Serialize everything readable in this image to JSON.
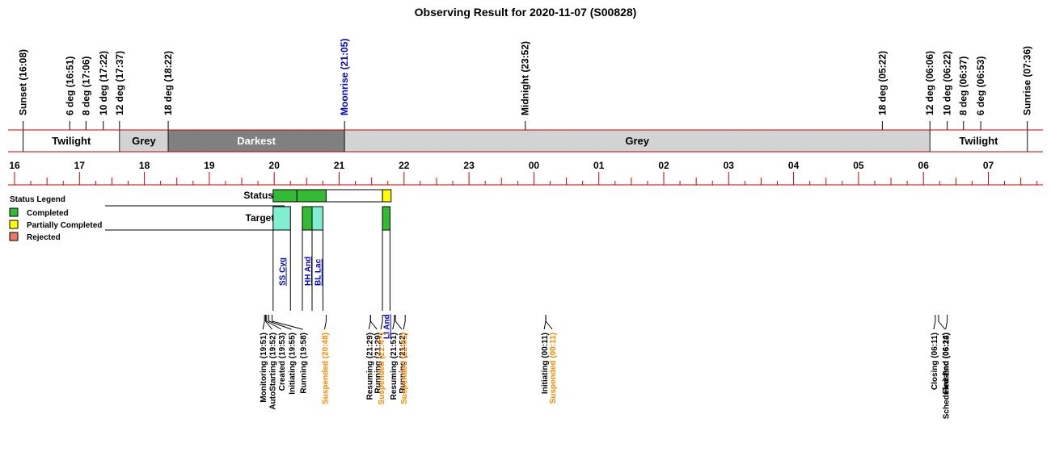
{
  "title": "Observing Result for 2020-11-07 (S00828)",
  "colors": {
    "rule": "#cc0000",
    "darkest": "#808080",
    "grey": "#d3d3d3",
    "twilight": "#ffffff",
    "completed": "#33bb33",
    "partial": "#ffff00",
    "rejected": "#ee7766",
    "target_fill": "#80eed0",
    "target_link": "#0000cc",
    "suspended": "#ff8800",
    "moonrise": "#0000cc"
  },
  "timeline": {
    "start_hour": 15.8,
    "end_hour": 31.75,
    "hour_labels": [
      "16",
      "17",
      "18",
      "19",
      "20",
      "21",
      "22",
      "23",
      "00",
      "01",
      "02",
      "03",
      "04",
      "05",
      "06",
      "07"
    ]
  },
  "bands": [
    {
      "label": "Twilight",
      "start": 16.133,
      "end": 17.617,
      "fill": "twilight"
    },
    {
      "label": "Grey",
      "start": 17.617,
      "end": 18.367,
      "fill": "grey"
    },
    {
      "label": "Darkest",
      "start": 18.367,
      "end": 21.083,
      "fill": "darkest"
    },
    {
      "label": "Grey",
      "start": 21.083,
      "end": 30.1,
      "fill": "grey"
    },
    {
      "label": "Twilight",
      "start": 30.1,
      "end": 31.6,
      "fill": "twilight"
    }
  ],
  "events": [
    {
      "label": "Sunset (16:08)",
      "time": 16.133,
      "color": "#000000"
    },
    {
      "label": "6 deg (16:51)",
      "time": 16.85,
      "color": "#000000"
    },
    {
      "label": "8 deg (17:06)",
      "time": 17.1,
      "color": "#000000"
    },
    {
      "label": "10 deg (17:22)",
      "time": 17.367,
      "color": "#000000"
    },
    {
      "label": "12 deg (17:37)",
      "time": 17.617,
      "color": "#000000"
    },
    {
      "label": "18 deg (18:22)",
      "time": 18.367,
      "color": "#000000"
    },
    {
      "label": "Moonrise (21:05)",
      "time": 21.083,
      "color": "#0000cc"
    },
    {
      "label": "Midnight (23:52)",
      "time": 23.867,
      "color": "#000000"
    },
    {
      "label": "18 deg (05:22)",
      "time": 29.367,
      "color": "#000000"
    },
    {
      "label": "12 deg (06:06)",
      "time": 30.1,
      "color": "#000000"
    },
    {
      "label": "10 deg (06:22)",
      "time": 30.367,
      "color": "#000000"
    },
    {
      "label": "8 deg (06:37)",
      "time": 30.617,
      "color": "#000000"
    },
    {
      "label": "6 deg (06:53)",
      "time": 30.883,
      "color": "#000000"
    },
    {
      "label": "Sunrise (07:36)",
      "time": 31.6,
      "color": "#000000"
    }
  ],
  "legend": {
    "title": "Status Legend",
    "items": [
      {
        "label": "Completed",
        "color": "completed"
      },
      {
        "label": "Partially Completed",
        "color": "partial"
      },
      {
        "label": "Rejected",
        "color": "rejected"
      }
    ]
  },
  "rows": {
    "status_label": "Status",
    "targets_label": "Targets"
  },
  "status_blocks": [
    {
      "start": 19.983,
      "end": 20.35,
      "state": "completed"
    },
    {
      "start": 20.35,
      "end": 20.8,
      "state": "completed"
    },
    {
      "start": 20.8,
      "end": 21.667,
      "state": "none"
    },
    {
      "start": 21.667,
      "end": 21.8,
      "state": "partial"
    }
  ],
  "targets": [
    {
      "name": "SS Cyg",
      "start": 19.983,
      "end": 20.25,
      "fill": "target_fill"
    },
    {
      "name": "HH And",
      "start": 20.433,
      "end": 20.583,
      "fill": "completed"
    },
    {
      "name": "BL Lac",
      "start": 20.583,
      "end": 20.75,
      "fill": "target_fill"
    },
    {
      "name": "LI And",
      "start": 21.667,
      "end": 21.783,
      "fill": "completed"
    }
  ],
  "log": [
    {
      "label": "Monitoring (19:51)",
      "time": 19.85,
      "suspended": false
    },
    {
      "label": "AutoStarting (19:52)",
      "time": 19.867,
      "suspended": false
    },
    {
      "label": "Created (19:53)",
      "time": 19.883,
      "suspended": false
    },
    {
      "label": "Initiating (19:55)",
      "time": 19.917,
      "suspended": false
    },
    {
      "label": "Running (19:58)",
      "time": 19.967,
      "suspended": false
    },
    {
      "label": "Suspended (20:48)",
      "time": 20.8,
      "suspended": true
    },
    {
      "label": "Resuming (21:29)",
      "time": 21.483,
      "suspended": false
    },
    {
      "label": "Running (21:29)",
      "time": 21.483,
      "suspended": false
    },
    {
      "label": "Suspended (21:4?)",
      "time": 21.667,
      "suspended": true
    },
    {
      "label": "Resuming (21:51)",
      "time": 21.85,
      "suspended": false
    },
    {
      "label": "Running (21:52)",
      "time": 21.867,
      "suspended": false
    },
    {
      "label": "Suspended (22:01)",
      "time": 22.017,
      "suspended": true
    },
    {
      "label": "Initiating (00:11)",
      "time": 24.183,
      "suspended": false
    },
    {
      "label": "Suspended (00:11)",
      "time": 24.183,
      "suspended": true
    },
    {
      "label": "Closing (06:11)",
      "time": 30.183,
      "suspended": false
    },
    {
      "label": "Finished (06:14)",
      "time": 30.233,
      "suspended": false
    },
    {
      "label": "Scheduled End (06:22)",
      "time": 30.367,
      "suspended": false
    }
  ]
}
